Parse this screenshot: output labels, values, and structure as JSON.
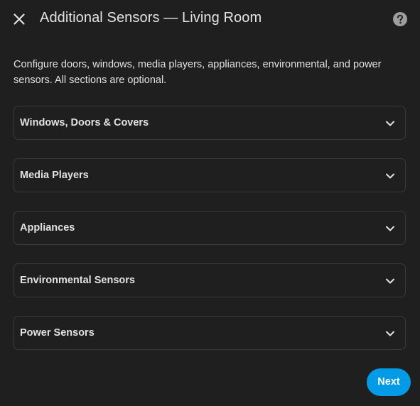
{
  "dialog": {
    "title": "Additional Sensors — Living Room",
    "close_icon": "close-icon",
    "help_icon": "help-icon"
  },
  "description": "Configure doors, windows, media players, appliances, environmental, and power sensors. All sections are optional.",
  "sections": [
    {
      "label": "Windows, Doors & Covers",
      "icon": "chevron-down-icon",
      "expanded": false
    },
    {
      "label": "Media Players",
      "icon": "chevron-down-icon",
      "expanded": false
    },
    {
      "label": "Appliances",
      "icon": "chevron-down-icon",
      "expanded": false
    },
    {
      "label": "Environmental Sensors",
      "icon": "chevron-down-icon",
      "expanded": false
    },
    {
      "label": "Power Sensors",
      "icon": "chevron-down-icon",
      "expanded": false
    }
  ],
  "footer": {
    "next_label": "Next"
  },
  "colors": {
    "background": "#1f1f1f",
    "border": "#3a3a3a",
    "accent": "#039be5",
    "text": "#e1e1e1"
  }
}
